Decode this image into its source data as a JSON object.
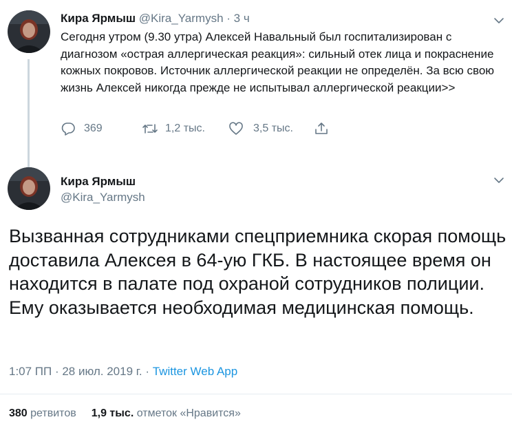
{
  "colors": {
    "text_primary": "#14171a",
    "text_secondary": "#657786",
    "link": "#1b95e0",
    "thread_line": "#ccd6dd"
  },
  "tweet1": {
    "author_name": "Кира Ярмыш",
    "author_handle": "@Kira_Yarmysh",
    "separator": " · ",
    "time": "3 ч",
    "text": "Сегодня утром (9.30 утра) Алексей Навальный был госпитализирован с диагнозом «острая аллергическая реакция»: сильный отек лица и покраснение кожных покровов. Источник аллергической реакции не определён. За всю свою жизнь Алексей никогда прежде не испытывал аллергической реакции>>",
    "actions": {
      "replies": "369",
      "retweets": "1,2 тыс.",
      "likes": "3,5 тыс."
    },
    "icons": [
      "reply-icon",
      "retweet-icon",
      "like-icon",
      "share-icon",
      "chevron-down-icon"
    ]
  },
  "tweet2": {
    "author_name": "Кира Ярмыш",
    "author_handle": "@Kira_Yarmysh",
    "text": "Вызванная сотрудниками спецприемника скорая помощь доставила Алексея в 64-ую ГКБ. В настоящее время он находится в палате под охраной сотрудников полиции. Ему оказывается необходимая медицинская помощь.",
    "timestamp": "1:07 ПП · 28 июл. 2019 г. · ",
    "source_app": "Twitter Web App",
    "retweet_count": "380",
    "retweet_label": " ретвитов",
    "like_count": "1,9 тыс.",
    "like_label": " отметок «Нравится»"
  }
}
